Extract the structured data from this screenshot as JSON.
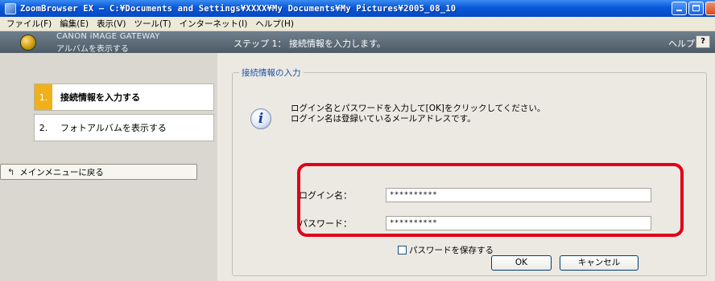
{
  "window": {
    "title": "ZoomBrowser EX  –  C:¥Documents and Settings¥XXXX¥My Documents¥My Pictures¥2005_08_10"
  },
  "menu": {
    "items": [
      "ファイル(F)",
      "編集(E)",
      "表示(V)",
      "ツール(T)",
      "インターネット(I)",
      "ヘルプ(H)"
    ]
  },
  "header": {
    "gateway_title": "CANON iMAGE GATEWAY",
    "gateway_subtitle": "アルバムを表示する",
    "step_title": "ステップ 1： 接続情報を入力します。",
    "help_label": "ヘルプ",
    "help_button": "?"
  },
  "sidebar": {
    "steps": [
      {
        "num": "1.",
        "label": "接続情報を入力する"
      },
      {
        "num": "2.",
        "label": "フォトアルバムを表示する"
      }
    ],
    "back_button": "メインメニューに戻る"
  },
  "form": {
    "group_title": "接続情報の入力",
    "message_line1": "ログイン名とパスワードを入力して[OK]をクリックしてください。",
    "message_line2": "ログイン名は登録いているメールアドレスです。",
    "login_label": "ログイン名：",
    "login_value": "**********",
    "password_label": "パスワード：",
    "password_value": "**********",
    "save_password_label": "パスワードを保存する",
    "save_password_checked": false,
    "ok_button": "OK",
    "cancel_button": "キャンセル"
  },
  "colors": {
    "highlight": "#e0001a",
    "active_step": "#f0b01a",
    "titlebar": "#0a58d8"
  },
  "icons": {
    "app": "app-icon",
    "gateway": "globe-icon",
    "info": "info-icon",
    "back": "return-arrow-icon"
  }
}
